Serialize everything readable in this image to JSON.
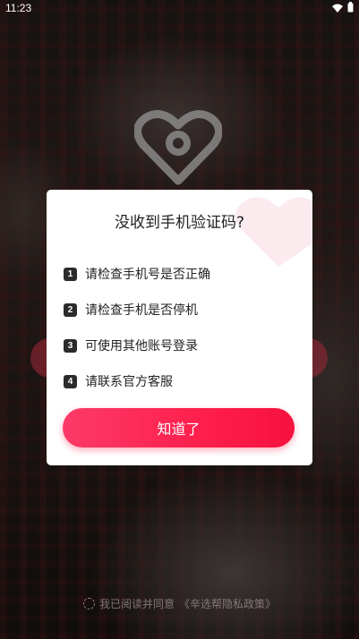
{
  "status_bar": {
    "time": "11:23",
    "icons": [
      "wifi-icon",
      "battery-icon"
    ]
  },
  "dialog": {
    "title": "没收到手机验证码?",
    "tips": [
      {
        "number": "1",
        "text": "请检查手机号是否正确"
      },
      {
        "number": "2",
        "text": "请检查手机是否停机"
      },
      {
        "number": "3",
        "text": "可使用其他账号登录"
      },
      {
        "number": "4",
        "text": "请联系官方客服"
      }
    ],
    "confirm_label": "知道了"
  },
  "agreement": {
    "prefix": "我已阅读并同意",
    "policy_link": "《辛选帮隐私政策》"
  },
  "colors": {
    "accent": "#ff1f4c",
    "dialog_bg": "#ffffff",
    "tip_badge": "#2b2b2b",
    "overlay": "rgba(0,0,0,0.45)"
  }
}
